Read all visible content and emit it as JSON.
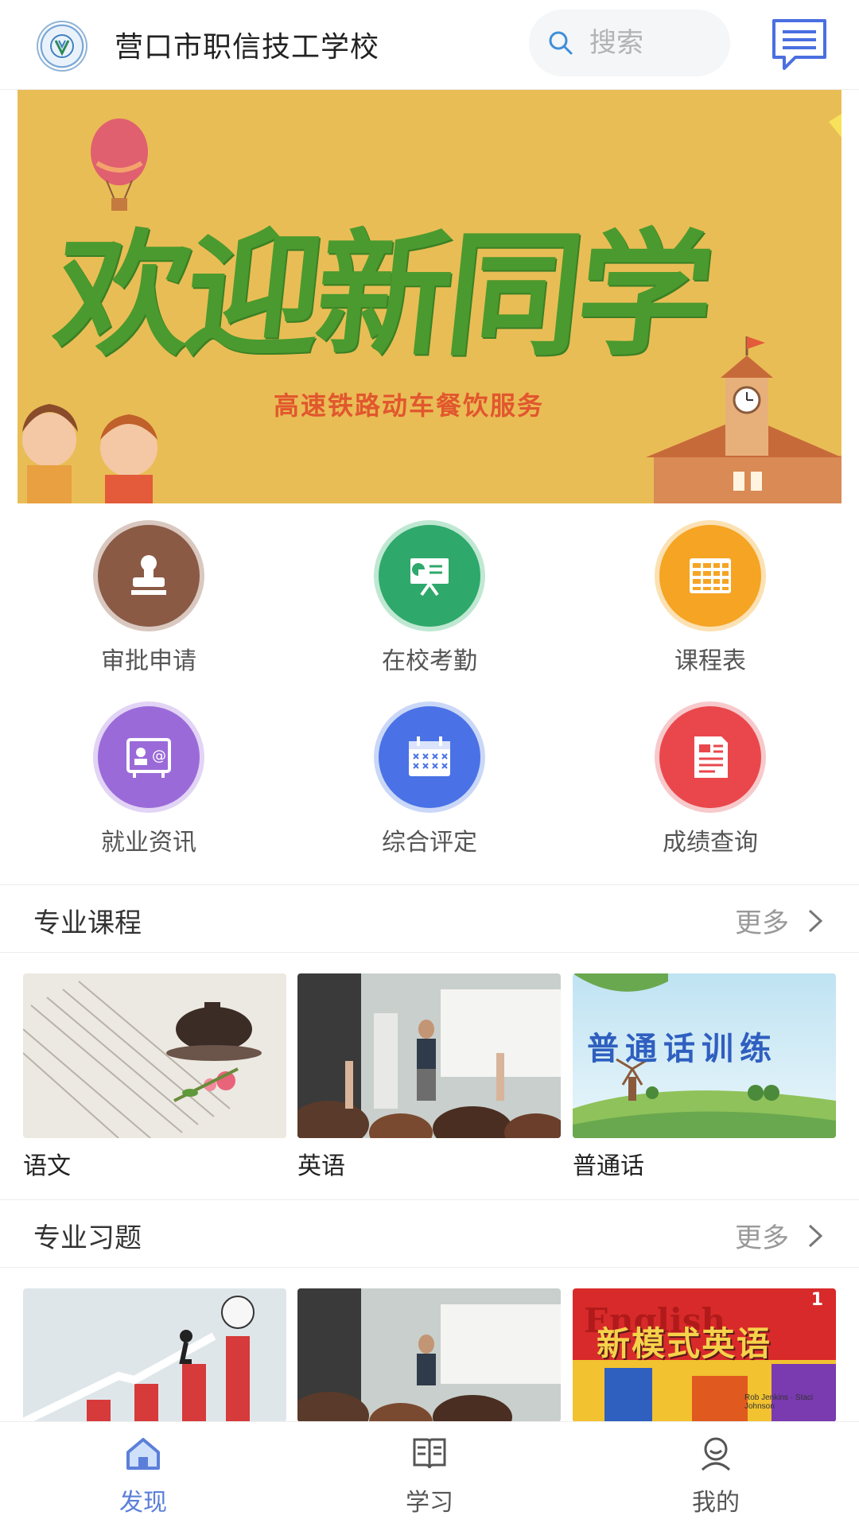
{
  "header": {
    "school_name": "营口市职信技工学校",
    "search_placeholder": "搜索",
    "logo_icon": "school-logo-icon",
    "message_icon": "message-icon"
  },
  "banner": {
    "title": "欢迎新同学",
    "subtitle": "高速铁路动车餐饮服务"
  },
  "grid": [
    {
      "label": "审批申请",
      "icon": "stamp-icon",
      "color": "#8a5a45"
    },
    {
      "label": "在校考勤",
      "icon": "presentation-icon",
      "color": "#2fa86b"
    },
    {
      "label": "课程表",
      "icon": "timetable-icon",
      "color": "#f5a423"
    },
    {
      "label": "就业资讯",
      "icon": "contact-card-icon",
      "color": "#9b6ad9"
    },
    {
      "label": "综合评定",
      "icon": "calendar-icon",
      "color": "#4a72e6"
    },
    {
      "label": "成绩查询",
      "icon": "document-icon",
      "color": "#e9474c"
    }
  ],
  "sections": [
    {
      "title": "专业课程",
      "more": "更多",
      "cards": [
        {
          "label": "语文"
        },
        {
          "label": "英语"
        },
        {
          "label": "普通话",
          "image_text": "普通话训练"
        }
      ]
    },
    {
      "title": "专业习题",
      "more": "更多",
      "cards": [
        {
          "label": ""
        },
        {
          "label": ""
        },
        {
          "label": "",
          "image_text": "新模式英语",
          "image_text_2": "English",
          "image_number": "1",
          "image_authors": "Rob Jenkins · Staci Johnson"
        }
      ]
    }
  ],
  "bottom_nav": [
    {
      "label": "发现",
      "icon": "home-icon",
      "active": true
    },
    {
      "label": "学习",
      "icon": "book-icon",
      "active": false
    },
    {
      "label": "我的",
      "icon": "user-icon",
      "active": false
    }
  ],
  "colors": {
    "accent": "#5b7fd9",
    "banner_bg": "#e9bd55"
  }
}
